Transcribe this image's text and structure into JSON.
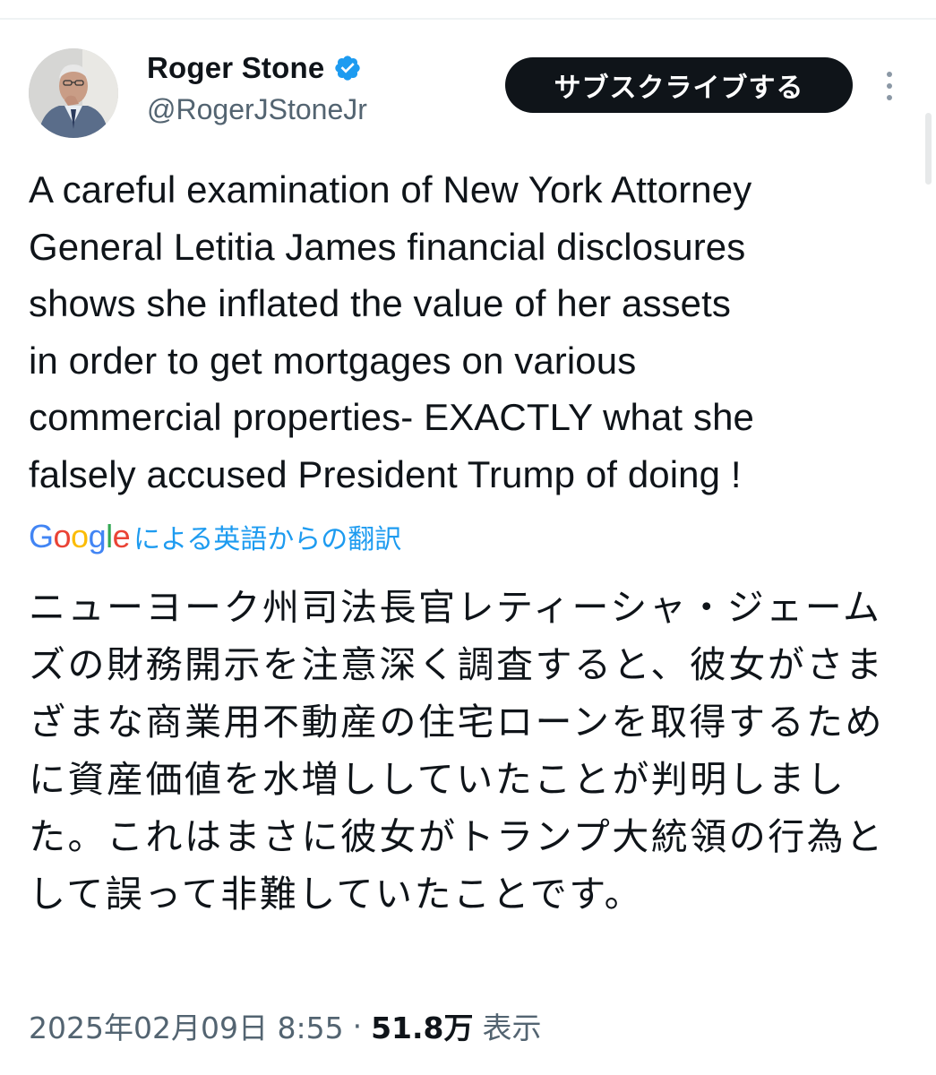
{
  "author": {
    "display_name": "Roger Stone",
    "handle": "@RogerJStoneJr",
    "verified": true
  },
  "actions": {
    "subscribe_label": "サブスクライブする"
  },
  "tweet": {
    "text": "A careful examination of New York Attorney\nGeneral Letitia James financial disclosures\nshows she inflated the value of her assets\nin order to get mortgages on various\ncommercial properties- EXACTLY what she\nfalsely accused President Trump of doing !",
    "translation_label": "による英語からの翻訳",
    "translation_logo": "Google",
    "translated_text": "ニューヨーク州司法長官レティーシャ・ジェームズの財務開示を注意深く調査すると、彼女がさまざまな商業用不動産の住宅ローンを取得するために資産価値を水増ししていたことが判明しました。これはまさに彼女がトランプ大統領の行為として誤って非難していたことです。"
  },
  "meta": {
    "timestamp": "2025年02月09日 8:55",
    "separator": "·",
    "views_count": "51.8万",
    "views_label": "表示"
  },
  "colors": {
    "verified": "#1d9bf0",
    "link": "#1d9bf0",
    "subscribe_bg": "#0f1419",
    "secondary_text": "#536471"
  }
}
